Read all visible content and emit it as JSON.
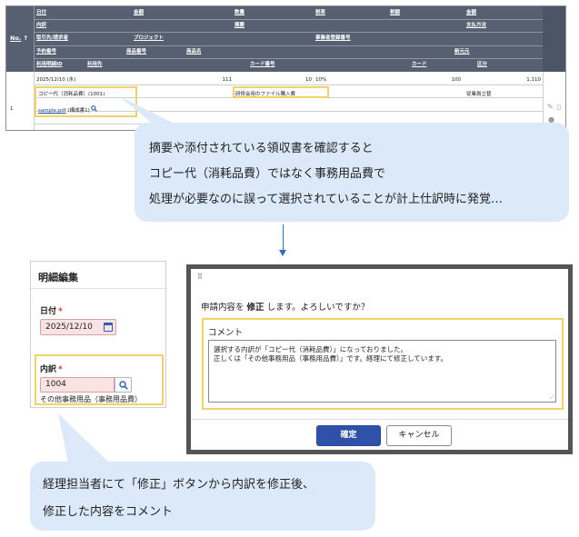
{
  "table": {
    "header": {
      "no": "No.",
      "sort_arrow": "↑",
      "row1": [
        "日付",
        "金額",
        "数量",
        "税率",
        "税額",
        "金額"
      ],
      "row2": [
        "内訳",
        "摘要",
        "支払方法"
      ],
      "row3": [
        "取引先/請求者",
        "プロジェクト",
        "事業者登録番号"
      ],
      "row4": [
        "予約番号",
        "商品番号",
        "商品名",
        "新元元"
      ],
      "row5": [
        "利用明細ID",
        "利用先",
        "カード番号",
        "カード",
        "区分"
      ]
    },
    "row": {
      "no": "1",
      "date": "2025/12/10 (水)",
      "unit_price": "111",
      "quantity": "10",
      "tax_rate": "10%",
      "tax_amount": "100",
      "amount": "1,110",
      "item": "コピー代（消耗品費）(1001)",
      "description": "研修会用のファイル購入費",
      "payment": "従業員立替",
      "attachment": "sample.pdf",
      "attachment_note": "(構成書1)"
    }
  },
  "callout_top": {
    "lines": [
      "摘要や添付されている領収書を確認すると",
      "コピー代（消耗品費）ではなく事務用品費で",
      "処理が必要なのに誤って選択されていることが計上仕訳時に発覚…"
    ]
  },
  "edit_panel": {
    "title": "明細編集",
    "date_label": "日付",
    "date_value": "2025/12/10",
    "item_label": "内訳",
    "item_code": "1004",
    "item_name": "その他事務用品（事務用品費）",
    "required_mark": "*"
  },
  "dialog": {
    "handle": "⠿",
    "message_pre": "申請内容を",
    "message_bold": "修正",
    "message_post": "します。よろしいですか？",
    "comment_label": "コメント",
    "comment_line1": "選択する内訳が「コピー代（消耗品費）」になっておりました。",
    "comment_line2": "正しくは「その他事務用品（事務用品費）」です。経理にて修正しています。",
    "ok_label": "確定",
    "cancel_label": "キャンセル"
  },
  "callout_bottom": {
    "lines": [
      "経理担当者にて「修正」ボタンから内訳を修正後、",
      "修正した内容をコメント"
    ]
  },
  "colors": {
    "header_bg": "#566071",
    "highlight": "#f0d468",
    "callout_bg": "#dce9f8",
    "primary_button": "#2f52a8",
    "arrow": "#2f6fc4"
  }
}
